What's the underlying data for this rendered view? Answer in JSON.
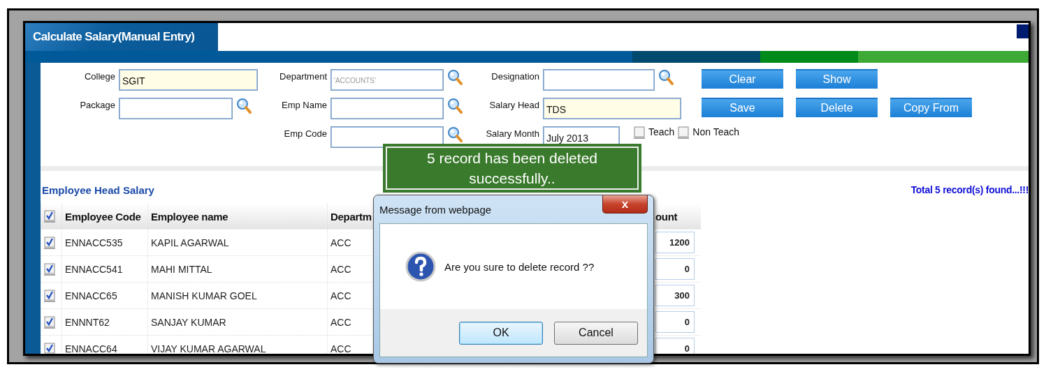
{
  "page": {
    "title": "Calculate Salary(Manual Entry)"
  },
  "form": {
    "fields": [
      {
        "label": "College",
        "value": "SGIT",
        "kind": "text",
        "highlighted": true
      },
      {
        "label": "Department",
        "placeholder": "'ACCOUNTS'",
        "kind": "lookup",
        "highlighted": false
      },
      {
        "label": "Designation",
        "kind": "lookup",
        "highlighted": false
      },
      {
        "label": "Package",
        "kind": "lookup",
        "highlighted": false
      },
      {
        "label": "Emp Name",
        "kind": "lookup",
        "highlighted": false
      },
      {
        "label": "Salary Head",
        "value": "TDS",
        "kind": "text",
        "highlighted": true
      },
      {
        "label": "Emp Code",
        "kind": "lookup",
        "highlighted": false
      },
      {
        "label": "Salary Month",
        "value": "July 2013",
        "kind": "text",
        "highlighted": false
      }
    ],
    "checkboxes": [
      {
        "label": "Teach",
        "checked": false
      },
      {
        "label": "Non Teach",
        "checked": false
      }
    ],
    "buttons": [
      "Clear",
      "Show",
      "Save",
      "Delete",
      "Copy From"
    ]
  },
  "section": {
    "title": "Employee Head Salary",
    "summary": "Total 5 record(s) found...!!!"
  },
  "table": {
    "all_checked": true,
    "columns": [
      "Employee Code",
      "Employee name",
      "Departm",
      "ount"
    ],
    "rows": [
      {
        "checked": true,
        "code": "ENNACC535",
        "name": "KAPIL AGARWAL",
        "department": "ACC",
        "amount": "1200"
      },
      {
        "checked": true,
        "code": "ENNACC541",
        "name": "MAHI MITTAL",
        "department": "ACC",
        "amount": "0"
      },
      {
        "checked": true,
        "code": "ENNACC65",
        "name": "MANISH KUMAR GOEL",
        "department": "ACC",
        "amount": "300"
      },
      {
        "checked": true,
        "code": "ENNNT62",
        "name": "SANJAY KUMAR",
        "department": "ACC",
        "amount": "0"
      },
      {
        "checked": true,
        "code": "ENNACC64",
        "name": "VIJAY KUMAR AGARWAL",
        "department": "ACC",
        "amount": "0"
      }
    ]
  },
  "toast": {
    "message": "5 record has been deleted successfully.."
  },
  "dialog": {
    "title": "Message from webpage",
    "close": "x",
    "message": "Are you sure to delete record ??",
    "buttons": [
      {
        "label": "OK",
        "focused": true
      },
      {
        "label": "Cancel",
        "focused": false
      }
    ]
  }
}
